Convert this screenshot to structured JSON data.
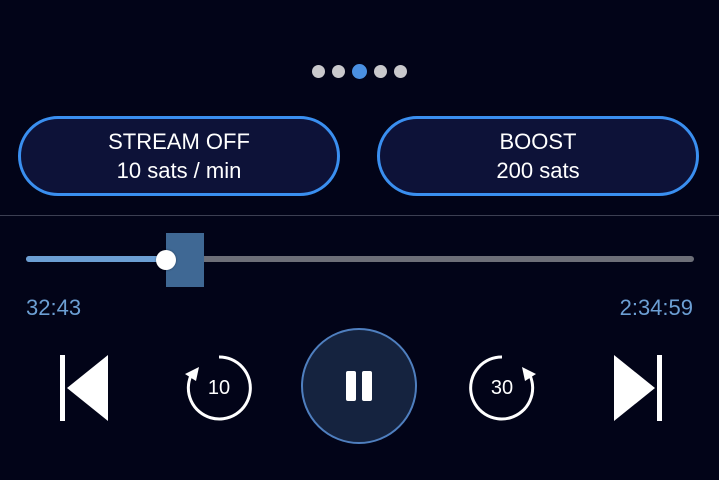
{
  "pagination": {
    "count": 5,
    "active_index": 2
  },
  "actions": {
    "stream": {
      "title": "STREAM OFF",
      "rate": "10 sats / min"
    },
    "boost": {
      "title": "BOOST",
      "amount": "200 sats"
    }
  },
  "player": {
    "elapsed": "32:43",
    "duration": "2:34:59",
    "progress_fraction": 0.21,
    "rewind_label": "10",
    "forward_label": "30",
    "state": "playing"
  },
  "icons": {
    "previous": "skip-previous-icon",
    "rewind": "rewind-10-icon",
    "pause": "pause-icon",
    "forward": "forward-30-icon",
    "next": "skip-next-icon"
  },
  "colors": {
    "background": "#020418",
    "accent": "#3a8ff0",
    "progress": "#6c9fd4",
    "pill_fill": "#0d1238"
  }
}
